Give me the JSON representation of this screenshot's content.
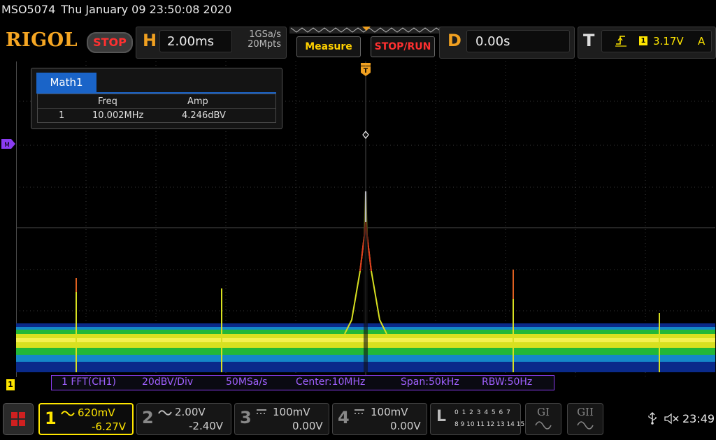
{
  "status": {
    "model": "MSO5074",
    "datetime": "Thu January 09 23:50:08 2020"
  },
  "header": {
    "brand": "RIGOL",
    "run_state": "STOP",
    "horizontal": {
      "letter": "H",
      "timebase": "2.00ms",
      "sample_rate": "1GSa/s",
      "memory_depth": "20Mpts"
    },
    "measure_label": "Measure",
    "stoprun_label": "STOP/RUN",
    "delay": {
      "letter": "D",
      "value": "0.00s"
    },
    "trigger": {
      "letter": "T",
      "source": "1",
      "level": "3.17V",
      "mode": "A"
    }
  },
  "markers": {
    "trigger_position": "T",
    "math_channel": "M",
    "ch1": "1"
  },
  "math_window": {
    "tab": "Math1",
    "columns": [
      "Freq",
      "Amp"
    ],
    "rows": [
      {
        "index": "1",
        "freq": "10.002MHz",
        "amp": "4.246dBV"
      }
    ]
  },
  "fft_info": {
    "source": "1 FFT(CH1)",
    "scale": "20dBV/Div",
    "rate": "50MSa/s",
    "center": "Center:10MHz",
    "span": "Span:50kHz",
    "rbw": "RBW:50Hz"
  },
  "channels": [
    {
      "num": "1",
      "scale": "620mV",
      "offset": "-6.27V",
      "coupling": "ac-wave-icon",
      "color": "#ffe600",
      "active": true
    },
    {
      "num": "2",
      "scale": "2.00V",
      "offset": "-2.40V",
      "coupling": "ac-wave-icon",
      "color": "#888888",
      "active": false
    },
    {
      "num": "3",
      "scale": "100mV",
      "offset": "0.00V",
      "coupling": "dc-icon",
      "color": "#888888",
      "active": false
    },
    {
      "num": "4",
      "scale": "100mV",
      "offset": "0.00V",
      "coupling": "dc-icon",
      "color": "#888888",
      "active": false
    }
  ],
  "la": {
    "letter": "L",
    "row1": "0 1 2 3  4 5 6 7",
    "row2": "8 9 10 11 12 13 14 15"
  },
  "generators": [
    {
      "label": "GI"
    },
    {
      "label": "GII"
    }
  ],
  "system": {
    "clock": "23:49",
    "icons": [
      "usb-icon",
      "speaker-muted-icon"
    ]
  },
  "colors": {
    "accent": "#f0a020",
    "ch1": "#ffe600",
    "math": "#8a3cf0",
    "stop": "#ff3030",
    "tab": "#1a64c8"
  }
}
